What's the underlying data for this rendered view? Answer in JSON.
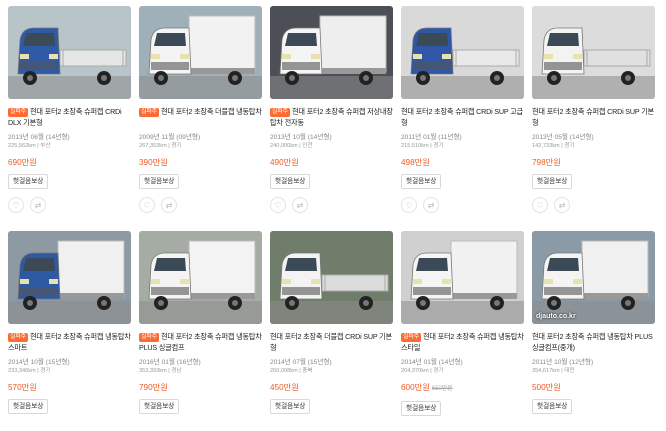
{
  "badge_text": "실파주",
  "button_label": "헛걸음보상",
  "listings": [
    {
      "badge": true,
      "title": "현대 포터2 초장축 슈퍼캡 CRDi DLX 기본형",
      "date": "2013년 06월 (14년형)",
      "sub": "225,562km | 부산",
      "price": "690만원",
      "old_price": "",
      "body_color": "#2f5aa8",
      "cargo": "flat",
      "cargo_color": "#e6e6e6",
      "bg": "#b9c4c8",
      "watermark": ""
    },
    {
      "badge": true,
      "title": "현대 포터2 초장축 더블캡 냉동탑차",
      "date": "2009년 11월 (09년형)",
      "sub": "267,353km | 경기",
      "price": "390만원",
      "old_price": "",
      "body_color": "#f4f4f4",
      "cargo": "box",
      "cargo_color": "#f2f2f2",
      "bg": "#9fb0b8",
      "watermark": ""
    },
    {
      "badge": true,
      "title": "현대 포터2 초장축 슈퍼캡 저상내장탑차 전자동",
      "date": "2013년 10월 (14년형)",
      "sub": "240,000km | 인천",
      "price": "490만원",
      "old_price": "",
      "body_color": "#f5f5f5",
      "cargo": "box",
      "cargo_color": "#eeeeee",
      "bg": "#4c4f55",
      "watermark": ""
    },
    {
      "badge": false,
      "title": "현대 포터2 초장축 슈퍼캡 CRDi SUP 고급형",
      "date": "2011년 01월 (11년형)",
      "sub": "215,510km | 경기",
      "price": "498만원",
      "old_price": "",
      "body_color": "#2e57a6",
      "cargo": "flat",
      "cargo_color": "#e9e9e9",
      "bg": "#d9d9d9",
      "watermark": ""
    },
    {
      "badge": false,
      "title": "현대 포터2 초장축 슈퍼캡 CRDi SUP 기본형",
      "date": "2013년 05월 (14년형)",
      "sub": "142,733km | 경기",
      "price": "798만원",
      "old_price": "",
      "body_color": "#f3f3f1",
      "cargo": "flat",
      "cargo_color": "#e0e0e0",
      "bg": "#dcdcdc",
      "watermark": ""
    },
    {
      "badge": true,
      "title": "현대 포터2 초장축 슈퍼캡 냉동탑차 스마트",
      "date": "2014년 10월 (15년형)",
      "sub": "233,346km | 경기",
      "price": "570만원",
      "old_price": "",
      "body_color": "#2e5aa2",
      "cargo": "box",
      "cargo_color": "#f0f0f0",
      "bg": "#8d9aa3",
      "watermark": ""
    },
    {
      "badge": true,
      "title": "현대 포터2 초장축 슈퍼캡 냉동탑차 PLUS 싱글컴프",
      "date": "2016년 01월 (16년형)",
      "sub": "353,393km | 경남",
      "price": "790만원",
      "old_price": "",
      "body_color": "#f4f4f4",
      "cargo": "box",
      "cargo_color": "#f3f3f3",
      "bg": "#a4aca4",
      "watermark": ""
    },
    {
      "badge": false,
      "title": "현대 포터2 초장축 더블캡 CRDi SUP 기본형",
      "date": "2014년 07월 (15년형)",
      "sub": "260,008km | 충북",
      "price": "450만원",
      "old_price": "",
      "body_color": "#f3f3f3",
      "cargo": "flat",
      "cargo_color": "#dcdcdc",
      "bg": "#6f7d6a",
      "watermark": ""
    },
    {
      "badge": true,
      "title": "현대 포터2 초장축 슈퍼캡 냉동탑차 스타일",
      "date": "2014년 01월 (14년형)",
      "sub": "204,370km | 경기",
      "price": "600만원",
      "old_price": "650만원",
      "body_color": "#f5f5f5",
      "cargo": "box",
      "cargo_color": "#f1f1f1",
      "bg": "#d0d0d0",
      "watermark": ""
    },
    {
      "badge": false,
      "title": "현대 포터2 초장축 슈퍼캡 냉동탑차 PLUS 싱글컴프(중개)",
      "date": "2011년 10월 (12년형)",
      "sub": "354,617km | 대전",
      "price": "500만원",
      "old_price": "",
      "body_color": "#f4f4f4",
      "cargo": "box",
      "cargo_color": "#f0f0f0",
      "bg": "#8a9aa6",
      "watermark": "djauto.co.kr"
    }
  ]
}
